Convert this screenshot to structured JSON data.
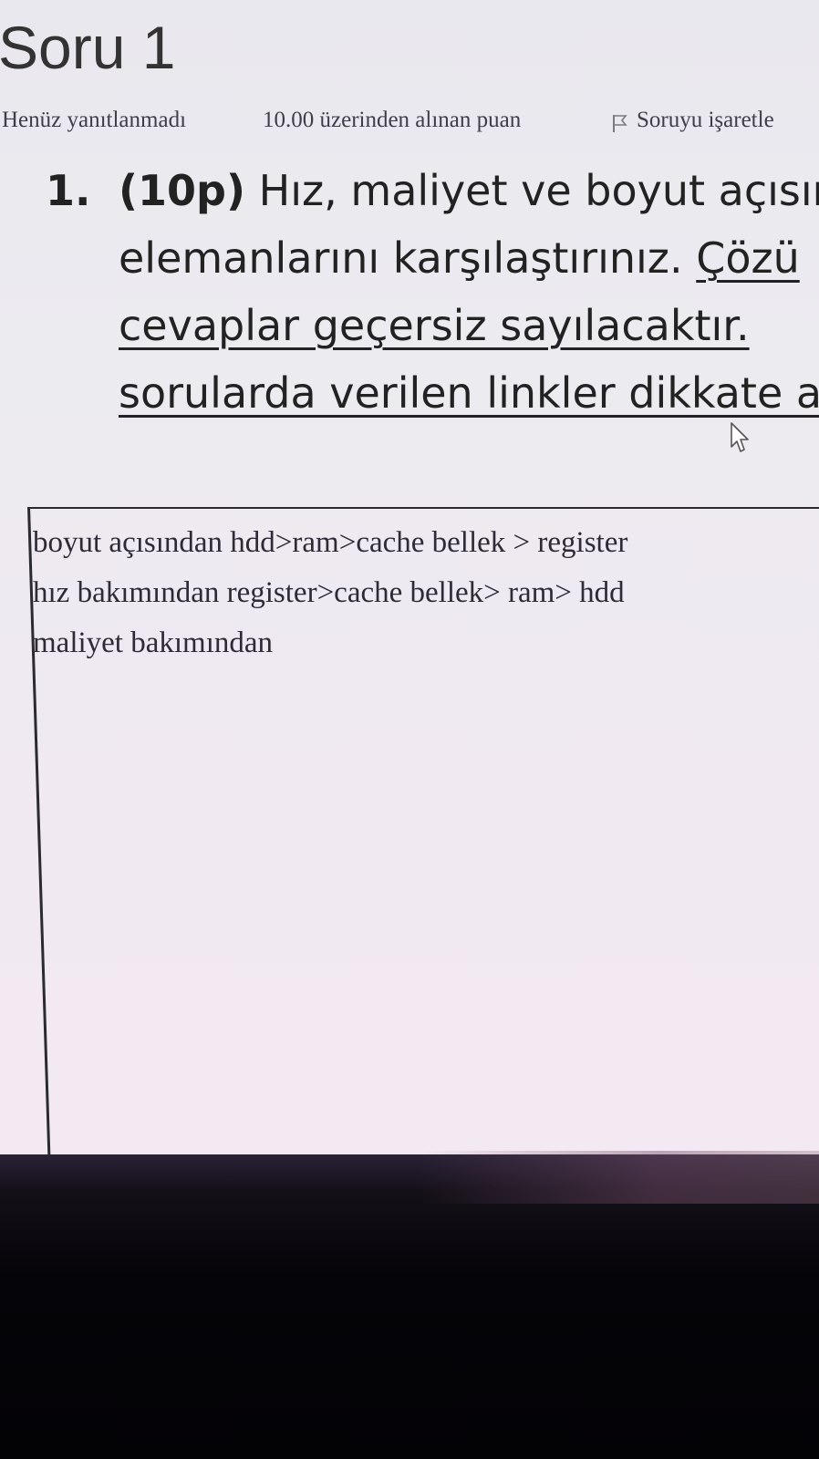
{
  "header": {
    "title": "Soru 1",
    "status": "Henüz yanıtlanmadı",
    "points": "10.00 üzerinden alınan puan",
    "flag_label": "Soruyu işaretle",
    "flag_icon": "flag-icon"
  },
  "question": {
    "number": "1.",
    "points_label": "(10p)",
    "line1": "Hız, maliyet ve boyut açısır",
    "line2_plain": "elemanlarını karşılaştırınız. ",
    "line2_underlined": "Çözü",
    "line3": "cevaplar  geçersiz  sayılacaktır.",
    "line4": "sorularda verilen linkler dikkate a"
  },
  "answer": {
    "lines": [
      "boyut açısından hdd>ram>cache bellek > register",
      "hız bakımından register>cache bellek> ram> hdd",
      "maliyet bakımından"
    ]
  },
  "colors": {
    "screen_bg": "#ecebf0",
    "text": "#222222",
    "bezel": "#050408"
  }
}
